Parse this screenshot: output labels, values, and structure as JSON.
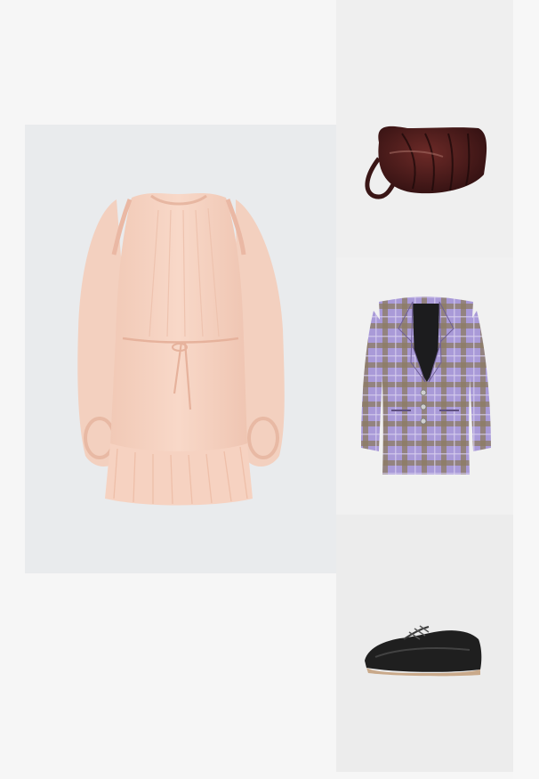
{
  "colors": {
    "page_background": "#f6f6f6",
    "dress_tile": "#e9ebed",
    "bag_tile": "#efefef",
    "blazer_tile": "#f1f1f1",
    "shoe_tile": "#ececec",
    "dress": "#f6d2c1",
    "bag": "#4a1b1a",
    "blazer_lilac": "#a99ad8",
    "blazer_tan": "#8c7a62",
    "shoe": "#1f1f1f"
  },
  "items": [
    {
      "icon": "dress-image"
    },
    {
      "icon": "bag-image"
    },
    {
      "icon": "blazer-image"
    },
    {
      "icon": "shoe-image"
    }
  ]
}
